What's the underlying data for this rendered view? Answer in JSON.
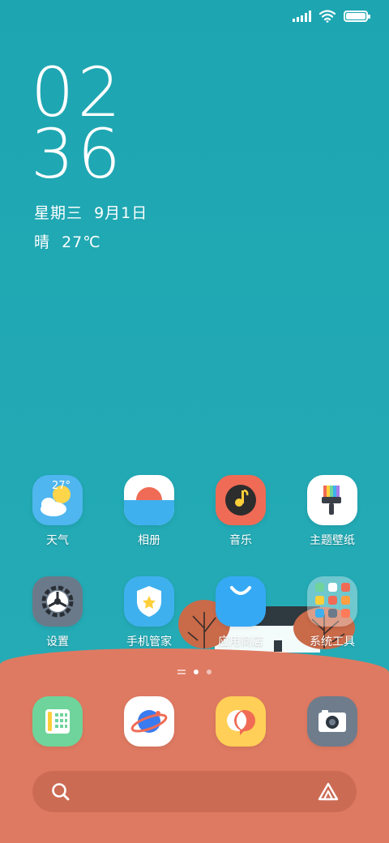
{
  "status_bar": {
    "signal_icon": "signal-icon",
    "wifi_icon": "wifi-icon",
    "battery_icon": "battery-icon",
    "battery_level": 1.0
  },
  "clock": {
    "hours": "02",
    "minutes": "36"
  },
  "date": "星期三  9月1日",
  "weather": "晴  27℃",
  "apps_row1": [
    {
      "label": "天气",
      "icon": "weather-icon",
      "badge_text": "27°"
    },
    {
      "label": "相册",
      "icon": "gallery-icon"
    },
    {
      "label": "音乐",
      "icon": "music-icon"
    },
    {
      "label": "主题壁纸",
      "icon": "themes-icon"
    }
  ],
  "apps_row2": [
    {
      "label": "设置",
      "icon": "settings-icon"
    },
    {
      "label": "手机管家",
      "icon": "security-icon"
    },
    {
      "label": "应用商店",
      "icon": "app-store-icon"
    },
    {
      "label": "系统工具",
      "icon": "folder-icon"
    }
  ],
  "dock": [
    {
      "name": "phone",
      "icon": "phone-icon"
    },
    {
      "name": "browser",
      "icon": "browser-icon"
    },
    {
      "name": "messages",
      "icon": "messages-icon"
    },
    {
      "name": "camera",
      "icon": "camera-icon"
    }
  ],
  "page_indicator": {
    "pages": 2,
    "active": 1
  },
  "search_bar": {
    "search_icon": "search-icon",
    "assistant_icon": "assistant-icon"
  },
  "colors": {
    "sky": "#20a7b3",
    "ground": "#df7a62",
    "weather_bg": "#4fb6f0",
    "music_bg": "#f06b55",
    "settings_bg": "#6b7a8a",
    "security_bg": "#3fb0ee",
    "store_bg": "#36a9f4",
    "phone_bg": "#6fd49b",
    "messages_bg": "#ffcf57",
    "camera_bg": "#6e7c8c"
  }
}
